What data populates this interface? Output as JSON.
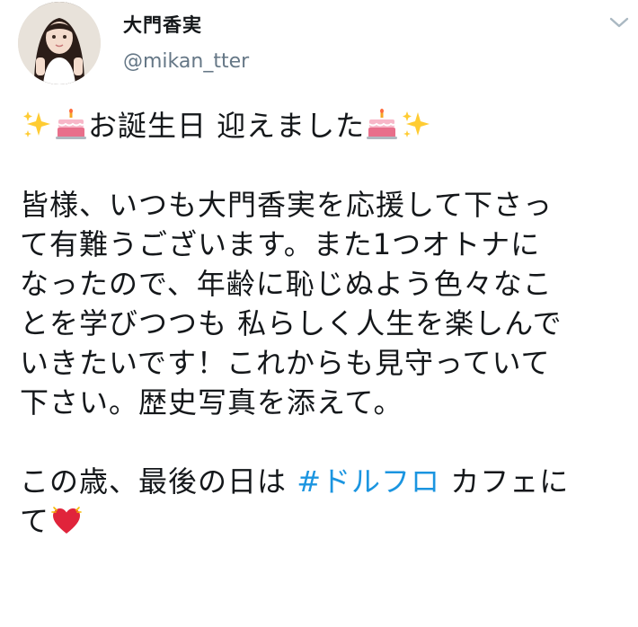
{
  "header": {
    "display_name": "大門香実",
    "handle": "@mikan_tter",
    "avatar_icon": "profile-photo",
    "menu_icon": "chevron-down-icon"
  },
  "tweet": {
    "line1_text": "お誕生日 迎えました",
    "paragraph1": [
      "皆様、いつも大門香実を応援して下さっ",
      "て有難うございます。また1つオトナに",
      "なったので、年齢に恥じぬよう色々なこ",
      "とを学びつつも 私らしく人生を楽しんで",
      "いきたいです！これからも見守っていて",
      "下さい。歴史写真を添えて。"
    ],
    "last_line_before": "この歳、最後の日は ",
    "hashtag": "#ドルフロ",
    "last_line_after": " カフェに",
    "final_text": "て"
  },
  "colors": {
    "link": "#1b95e0",
    "handle": "#657786",
    "text": "#14171a"
  }
}
